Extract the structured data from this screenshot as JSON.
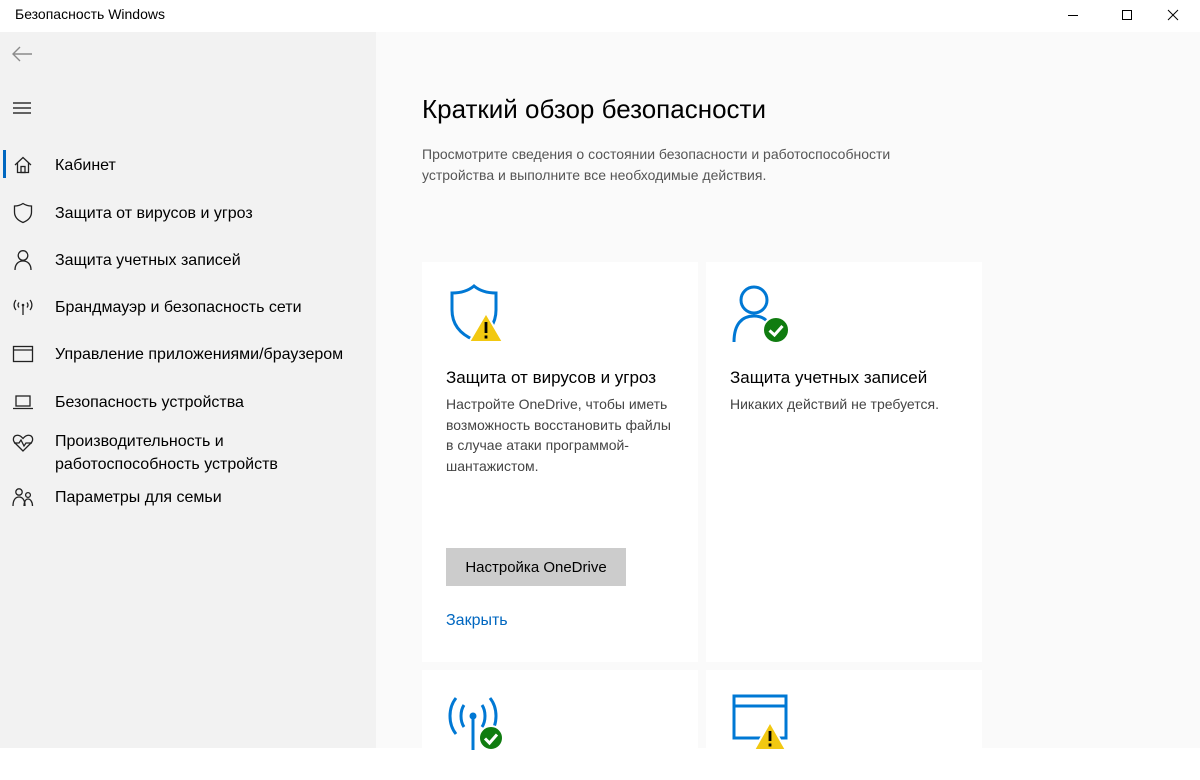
{
  "window": {
    "title": "Безопасность Windows"
  },
  "sidebar": {
    "items": [
      {
        "label": "Кабинет",
        "icon": "home-icon",
        "active": true
      },
      {
        "label": "Защита от вирусов и угроз",
        "icon": "shield-icon"
      },
      {
        "label": "Защита учетных записей",
        "icon": "person-icon"
      },
      {
        "label": "Брандмауэр и безопасность сети",
        "icon": "wifi-antenna-icon"
      },
      {
        "label": "Управление приложениями/браузером",
        "icon": "app-window-icon"
      },
      {
        "label": "Безопасность устройства",
        "icon": "laptop-icon"
      },
      {
        "label": "Производительность и работоспособность устройств",
        "icon": "heart-pulse-icon"
      },
      {
        "label": "Параметры для семьи",
        "icon": "family-icon"
      }
    ]
  },
  "main": {
    "title": "Краткий обзор безопасности",
    "description": "Просмотрите сведения о состоянии безопасности и работоспособности устройства и выполните все необходимые действия.",
    "cards": {
      "virus": {
        "title": "Защита от вирусов и угроз",
        "text": "Настройте OneDrive, чтобы иметь возможность восстановить файлы в случае атаки программой-шантажистом.",
        "button": "Настройка OneDrive",
        "link": "Закрыть",
        "status": "warning"
      },
      "account": {
        "title": "Защита учетных записей",
        "text": "Никаких действий не требуется.",
        "status": "ok"
      },
      "firewall": {
        "status": "ok"
      },
      "apps": {
        "status": "warning"
      }
    }
  },
  "colors": {
    "accent": "#0067c0",
    "icon_blue": "#0078d4",
    "ok_green": "#107c10",
    "warn_yellow": "#f2c811",
    "sidebar_bg": "#f2f2f2",
    "main_bg": "#fafafa"
  }
}
